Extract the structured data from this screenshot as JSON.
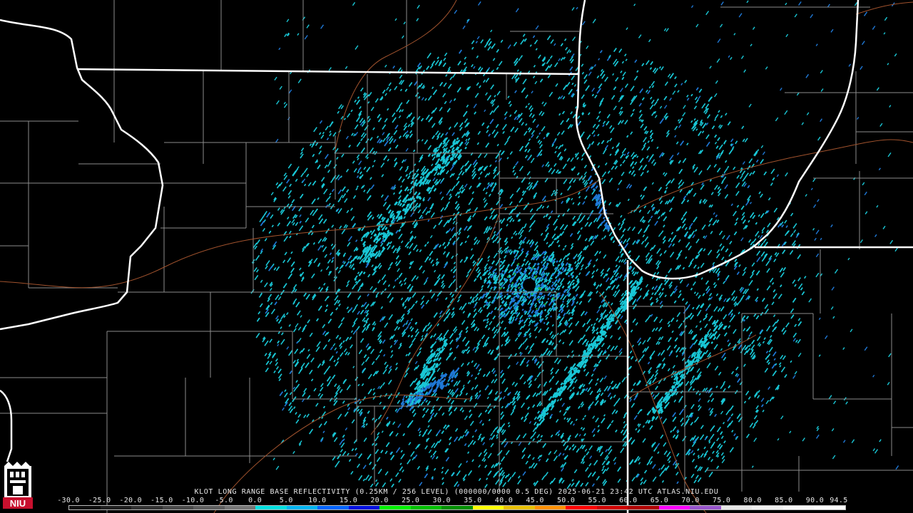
{
  "product_caption": "KLOT LONG RANGE BASE REFLECTIVITY (0.25KM / 256 LEVEL) (000000/0000 0.5 DEG) 2025-06-21 23:42 UTC  ATLAS.NIU.EDU",
  "logo_text": "NIU",
  "colorbar": {
    "labels": [
      "-30.0",
      "-25.0",
      "-20.0",
      "-15.0",
      "-10.0",
      "-5.0",
      "0.0",
      "5.0",
      "10.0",
      "15.0",
      "20.0",
      "25.0",
      "30.0",
      "35.0",
      "40.0",
      "45.0",
      "50.0",
      "55.0",
      "60.0",
      "65.0",
      "70.0",
      "75.0",
      "80.0",
      "85.0",
      "90.0",
      "94.5"
    ],
    "colors": [
      "#0d0d0d",
      "#1f1f1f",
      "#333333",
      "#4a4a4a",
      "#5e5e5e",
      "#767676",
      "#00e0e0",
      "#00b4f0",
      "#0064ff",
      "#0010e0",
      "#00f000",
      "#00c000",
      "#009000",
      "#ffff00",
      "#e8c000",
      "#ff9000",
      "#ff0000",
      "#d00000",
      "#b00000",
      "#ff00ff",
      "#9955cc",
      "#e8e8e8",
      "#f0f0f0",
      "#f8f8f8",
      "#ffffff"
    ]
  },
  "colors": {
    "background": "#000000",
    "state_border": "#ffffff",
    "county_line": "#8c8c8c",
    "highway": "#a0522d",
    "echo_main": "#19c7d6",
    "echo_blue": "#1f78d6",
    "echo_green": "#20a020"
  },
  "radar_site": "KLOT"
}
